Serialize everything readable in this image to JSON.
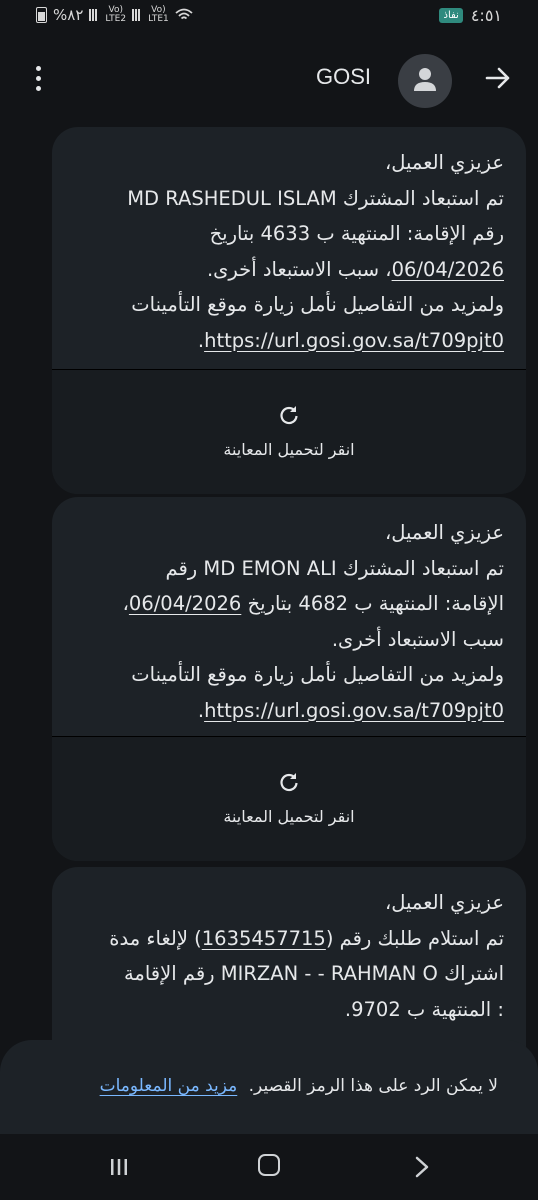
{
  "status_bar": {
    "battery_text": "%٨٢",
    "sim1": "Vo)) LTE2",
    "sim2": "Vo)) LTE1",
    "time": "٤:٥١",
    "app_badge": "نفاذ"
  },
  "header": {
    "title": "GOSI",
    "icons": [
      "more-vert-icon",
      "avatar-icon",
      "back-arrow-icon"
    ]
  },
  "messages": [
    {
      "lines": [
        "عزيزي العميل،",
        "تم استبعاد المشترك MD RASHEDUL ISLAM",
        "رقم الإقامة: المنتهية ب 4633 بتاريخ",
        "06/04/2026، سبب الاستبعاد أخرى.",
        "ولمزيد من التفاصيل نأمل زيارة موقع التأمينات",
        "https://url.gosi.gov.sa/t709pjt0."
      ],
      "preview_label": "انقر لتحميل المعاينة"
    },
    {
      "lines": [
        "عزيزي العميل،",
        "تم استبعاد المشترك MD EMON ALI رقم",
        "الإقامة: المنتهية ب 4682 بتاريخ 06/04/2026،",
        "سبب الاستبعاد أخرى.",
        "ولمزيد من التفاصيل نأمل زيارة موقع التأمينات",
        "https://url.gosi.gov.sa/t709pjt0."
      ],
      "preview_label": "انقر لتحميل المعاينة"
    },
    {
      "lines": [
        "عزيزي العميل،",
        "تم استلام طلبك رقم (1635457715) لإلغاء مدة",
        "اشتراك MIRZAN - - RAHMAN O رقم الإقامة",
        ": المنتهية ب 9702."
      ]
    }
  ],
  "reply_bar": {
    "text": "لا يمكن الرد على هذا الرمز القصير.",
    "link": "مزيد من المعلومات"
  },
  "nav_bar": {
    "icons": [
      "recents-icon",
      "home-icon",
      "back-icon"
    ]
  }
}
